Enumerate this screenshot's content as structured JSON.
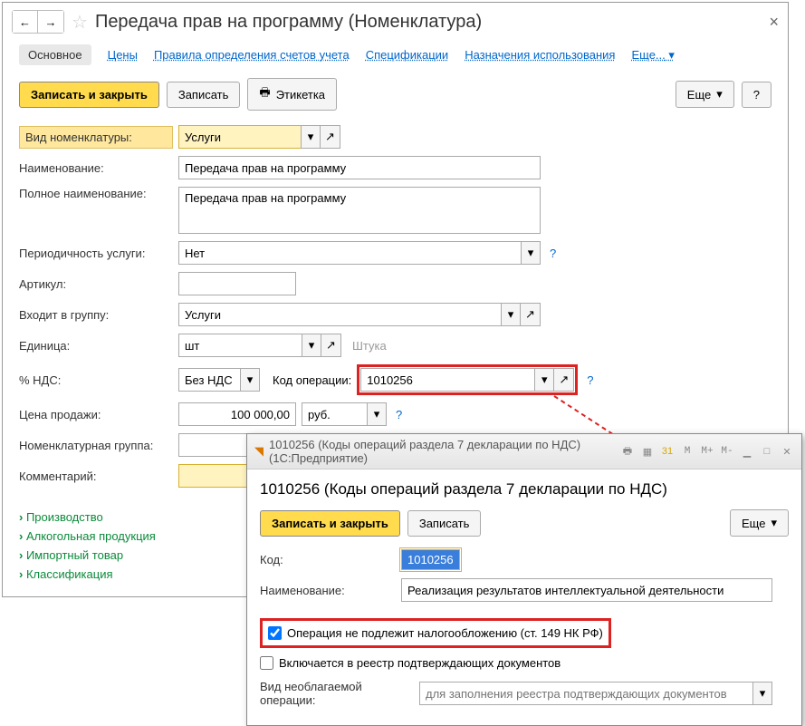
{
  "main": {
    "title": "Передача прав на программу (Номенклатура)",
    "tabs": {
      "main": "Основное",
      "prices": "Цены",
      "rules": "Правила определения счетов учета",
      "specs": "Спецификации",
      "usage": "Назначения использования",
      "more": "Еще..."
    },
    "toolbar": {
      "save_close": "Записать и закрыть",
      "save": "Записать",
      "label": "Этикетка",
      "more": "Еще",
      "help": "?"
    },
    "fields": {
      "kind_label": "Вид номенклатуры:",
      "kind_value": "Услуги",
      "name_label": "Наименование:",
      "name_value": "Передача прав на программу",
      "fullname_label": "Полное наименование:",
      "fullname_value": "Передача прав на программу",
      "period_label": "Периодичность услуги:",
      "period_value": "Нет",
      "article_label": "Артикул:",
      "article_value": "",
      "group_label": "Входит в группу:",
      "group_value": "Услуги",
      "unit_label": "Единица:",
      "unit_value": "шт",
      "unit_hint": "Штука",
      "vat_label": "% НДС:",
      "vat_value": "Без НДС",
      "opcode_label": "Код операции:",
      "opcode_value": "1010256",
      "price_label": "Цена продажи:",
      "price_value": "100 000,00",
      "currency": "руб.",
      "nomgroup_label": "Номенклатурная группа:",
      "nomgroup_value": "",
      "comment_label": "Комментарий:",
      "comment_value": ""
    },
    "tree": [
      "Производство",
      "Алкогольная продукция",
      "Импортный товар",
      "Классификация"
    ]
  },
  "popup": {
    "wintitle": "1010256 (Коды операций раздела 7 декларации по НДС)  (1С:Предприятие)",
    "heading": "1010256 (Коды операций раздела 7 декларации по НДС)",
    "save_close": "Записать и закрыть",
    "save": "Записать",
    "more": "Еще",
    "code_label": "Код:",
    "code_value": "1010256",
    "name_label": "Наименование:",
    "name_value": "Реализация результатов интеллектуальной деятельности",
    "chk1": "Операция не подлежит налогообложению (ст. 149 НК РФ)",
    "chk2": "Включается в реестр подтверждающих документов",
    "vid_label": "Вид необлагаемой операции:",
    "vid_placeholder": "для заполнения реестра подтверждающих документов",
    "tb_letters": [
      "M",
      "M+",
      "M-"
    ]
  }
}
